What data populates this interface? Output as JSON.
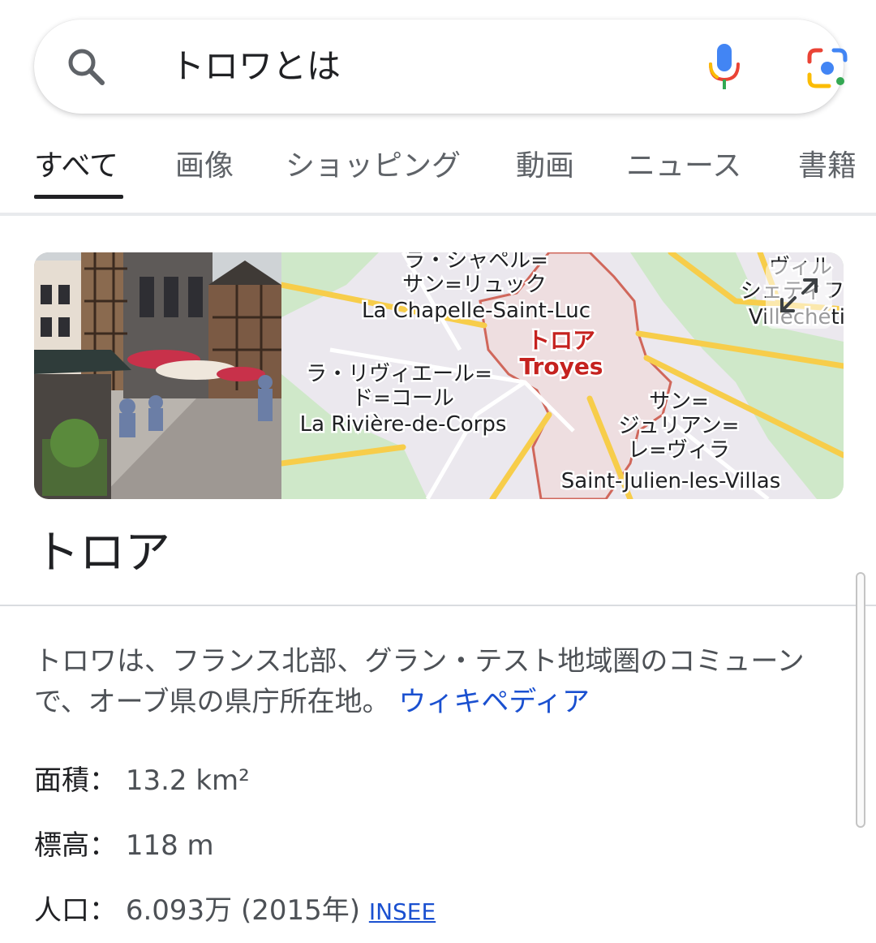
{
  "search": {
    "query": "トロワとは",
    "search_icon": "search-icon",
    "mic_icon": "microphone-icon",
    "lens_icon": "google-lens-icon"
  },
  "tabs": [
    {
      "label": "すべて",
      "active": true
    },
    {
      "label": "画像"
    },
    {
      "label": "ショッピング"
    },
    {
      "label": "動画"
    },
    {
      "label": "ニュース"
    },
    {
      "label": "書籍"
    }
  ],
  "map": {
    "labels": {
      "chapelle_jp_1": "ラ・シャペル=",
      "chapelle_jp_2": "サン=リュック",
      "chapelle_fr": "La Chapelle-Saint-Luc",
      "troyes_jp": "トロア",
      "troyes_fr": "Troyes",
      "riviere_jp_1": "ラ・リヴィエール=",
      "riviere_jp_2": "ド=コール",
      "riviere_fr": "La Rivière-de-Corps",
      "julien_jp_1": "サン=",
      "julien_jp_2": "ジュリアン=",
      "julien_jp_3": "レ=ヴィラ",
      "julien_fr": "Saint-Julien-les-Villas",
      "villechetif_jp_1": "ヴィル",
      "villechetif_jp_2": "シェティフ",
      "villechetif_fr": "Villechétif"
    },
    "expand_icon": "expand-icon"
  },
  "entity": {
    "title": "トロア",
    "description": "トロワは、フランス北部、グラン・テスト地域圏のコミューンで、オーブ県の県庁所在地。",
    "source_link": "ウィキペディア",
    "facts": [
      {
        "key": "面積",
        "value": "13.2 km²",
        "source": ""
      },
      {
        "key": "標高",
        "value": "118 m",
        "source": ""
      },
      {
        "key": "人口",
        "value": "6.093万 (2015年)",
        "source": "INSEE"
      }
    ]
  },
  "colors": {
    "accent_link": "#1a50d0",
    "map_green": "#cfe8c9",
    "map_city": "#ebe8ee",
    "map_road": "#f7cd4a",
    "map_boundary": "#d0675b"
  }
}
